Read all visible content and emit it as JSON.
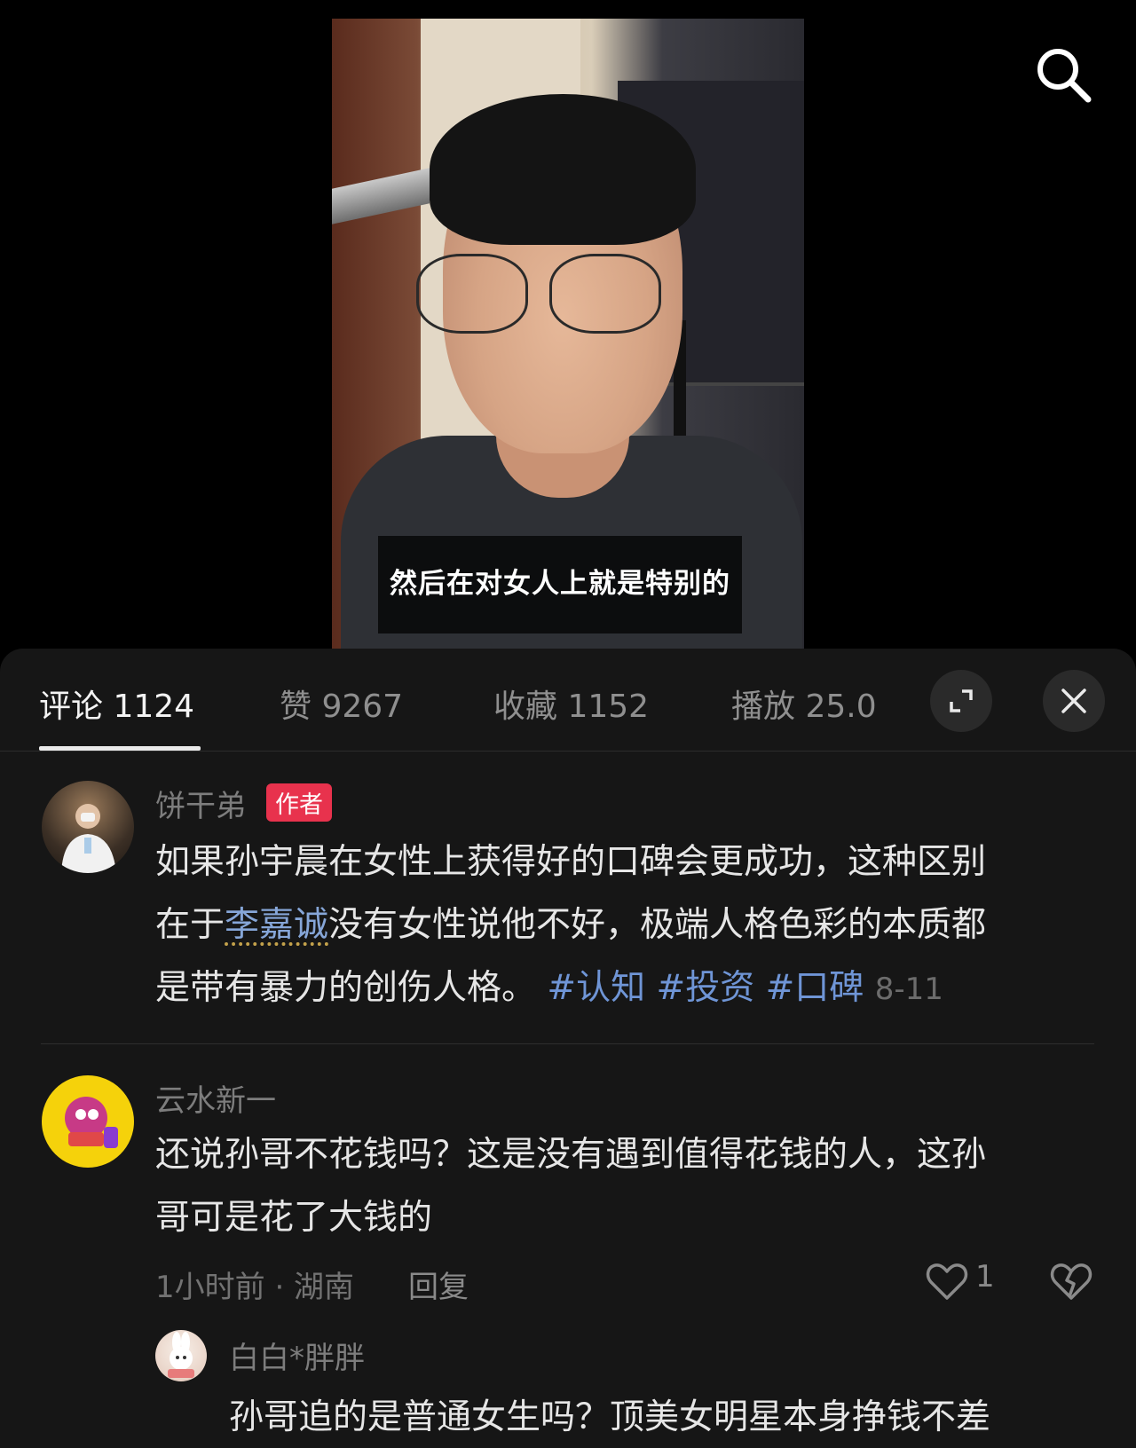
{
  "video": {
    "subtitle": "然后在对女人上就是特别的"
  },
  "tabs": [
    {
      "label": "评论 1124",
      "active": true
    },
    {
      "label": "赞 9267",
      "active": false
    },
    {
      "label": "收藏 1152",
      "active": false
    },
    {
      "label": "播放 25.0",
      "active": false
    }
  ],
  "icons": {
    "search": "search-icon",
    "expand": "expand-icon",
    "close": "close-icon",
    "like": "heart-icon",
    "dislike": "broken-heart-icon"
  },
  "colors": {
    "author_badge": "#e8324d",
    "hashtag": "#6f95d6",
    "panel_bg": "#161616"
  },
  "comments": [
    {
      "username": "饼干弟",
      "badge": "作者",
      "line1": "如果孙宇晨在女性上获得好的口碑会更成功，这种区别",
      "line2_prefix": "在于",
      "mention": "李嘉诚",
      "line2_suffix": "没有女性说他不好，极端人格色彩的本质都",
      "line3": "是带有暴力的创伤人格。",
      "hashtags": [
        "#认知",
        "#投资",
        "#口碑"
      ],
      "date": "8-11"
    },
    {
      "username": "云水新一",
      "line1": "还说孙哥不花钱吗？这是没有遇到值得花钱的人，这孙",
      "line2": "哥可是花了大钱的",
      "time_location": "1小时前 · 湖南",
      "reply_label": "回复",
      "like_count": "1"
    },
    {
      "username": "白白*胖胖",
      "line1": "孙哥追的是普通女生吗？顶美女明星本身挣钱不差"
    }
  ]
}
